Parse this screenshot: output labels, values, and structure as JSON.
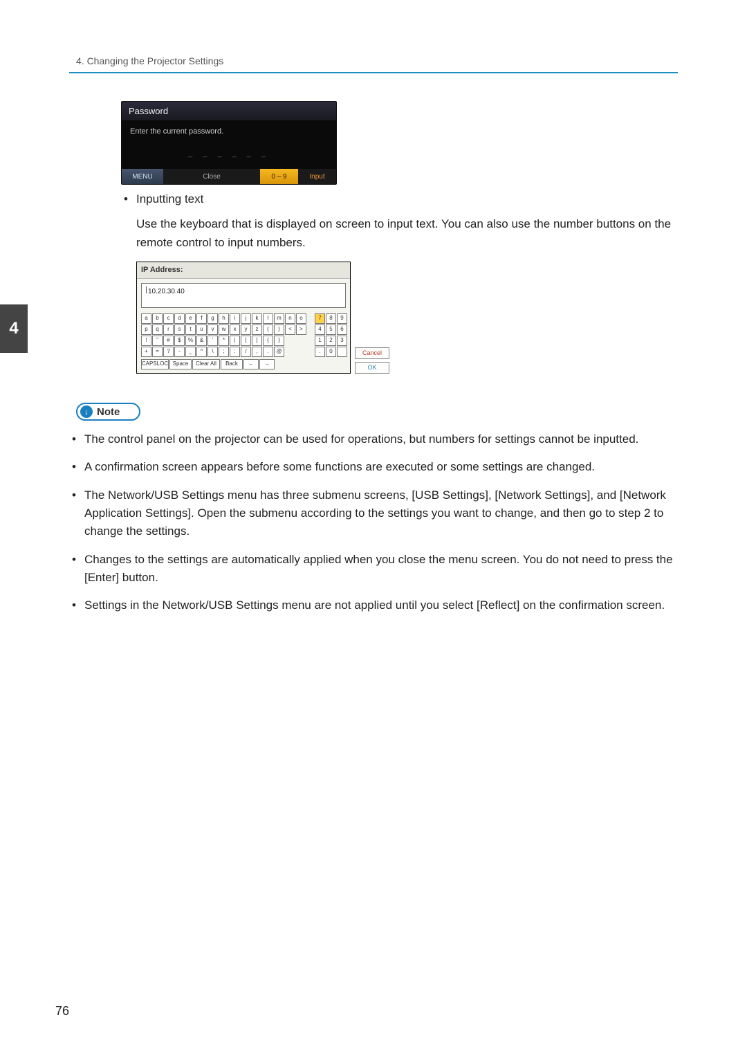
{
  "header": {
    "breadcrumb": "4. Changing the Projector Settings",
    "chapter_num": "4",
    "page_number": "76"
  },
  "fig1": {
    "title": "Password",
    "prompt": "Enter the current password.",
    "slots": "_ _ _ _ _ _",
    "menu": "MENU",
    "close": "Close",
    "num": "0 – 9",
    "input": "Input"
  },
  "bullet1": {
    "title": "Inputting text",
    "text": "Use the keyboard that is displayed on screen to input text. You can also use the number buttons on the remote control to input numbers."
  },
  "fig2": {
    "title": "IP Address:",
    "value": "10.20.30.40",
    "rows": {
      "r1": [
        "a",
        "b",
        "c",
        "d",
        "e",
        "f",
        "g",
        "h",
        "i",
        "j",
        "k",
        "l",
        "m",
        "n",
        "o"
      ],
      "r2": [
        "p",
        "q",
        "r",
        "s",
        "t",
        "u",
        "v",
        "w",
        "x",
        "y",
        "z",
        "(",
        ")",
        "<",
        ">"
      ],
      "r3": [
        "!",
        "\"",
        "#",
        "$",
        "%",
        "&",
        "'",
        "*",
        "|",
        "[",
        "]",
        "{",
        "}"
      ],
      "r4": [
        "+",
        "=",
        "?",
        "-",
        "_",
        "^",
        "\\",
        ";",
        ":",
        "/",
        ",",
        ".",
        "@"
      ]
    },
    "numpad": [
      [
        "7",
        "8",
        "9"
      ],
      [
        "4",
        "5",
        "6"
      ],
      [
        "1",
        "2",
        "3"
      ],
      [
        ".",
        "0",
        " "
      ]
    ],
    "bottom": {
      "caps": "CAPSLOC",
      "space": "Space",
      "clear": "Clear All",
      "back": "Back",
      "left": "←",
      "right": "→"
    },
    "cancel": "Cancel",
    "ok": "OK"
  },
  "note": {
    "label": "Note",
    "items": [
      "The control panel on the projector can be used for operations, but numbers for settings cannot be inputted.",
      "A confirmation screen appears before some functions are executed or some settings are changed.",
      "The Network/USB Settings menu has three submenu screens, [USB Settings], [Network Settings], and [Network Application Settings]. Open the submenu according to the settings you want to change, and then go to step 2 to change the settings.",
      "Changes to the settings are automatically applied when you close the menu screen. You do not need to press the [Enter] button.",
      "Settings in the Network/USB Settings menu are not applied until you select [Reflect] on the confirmation screen."
    ]
  }
}
